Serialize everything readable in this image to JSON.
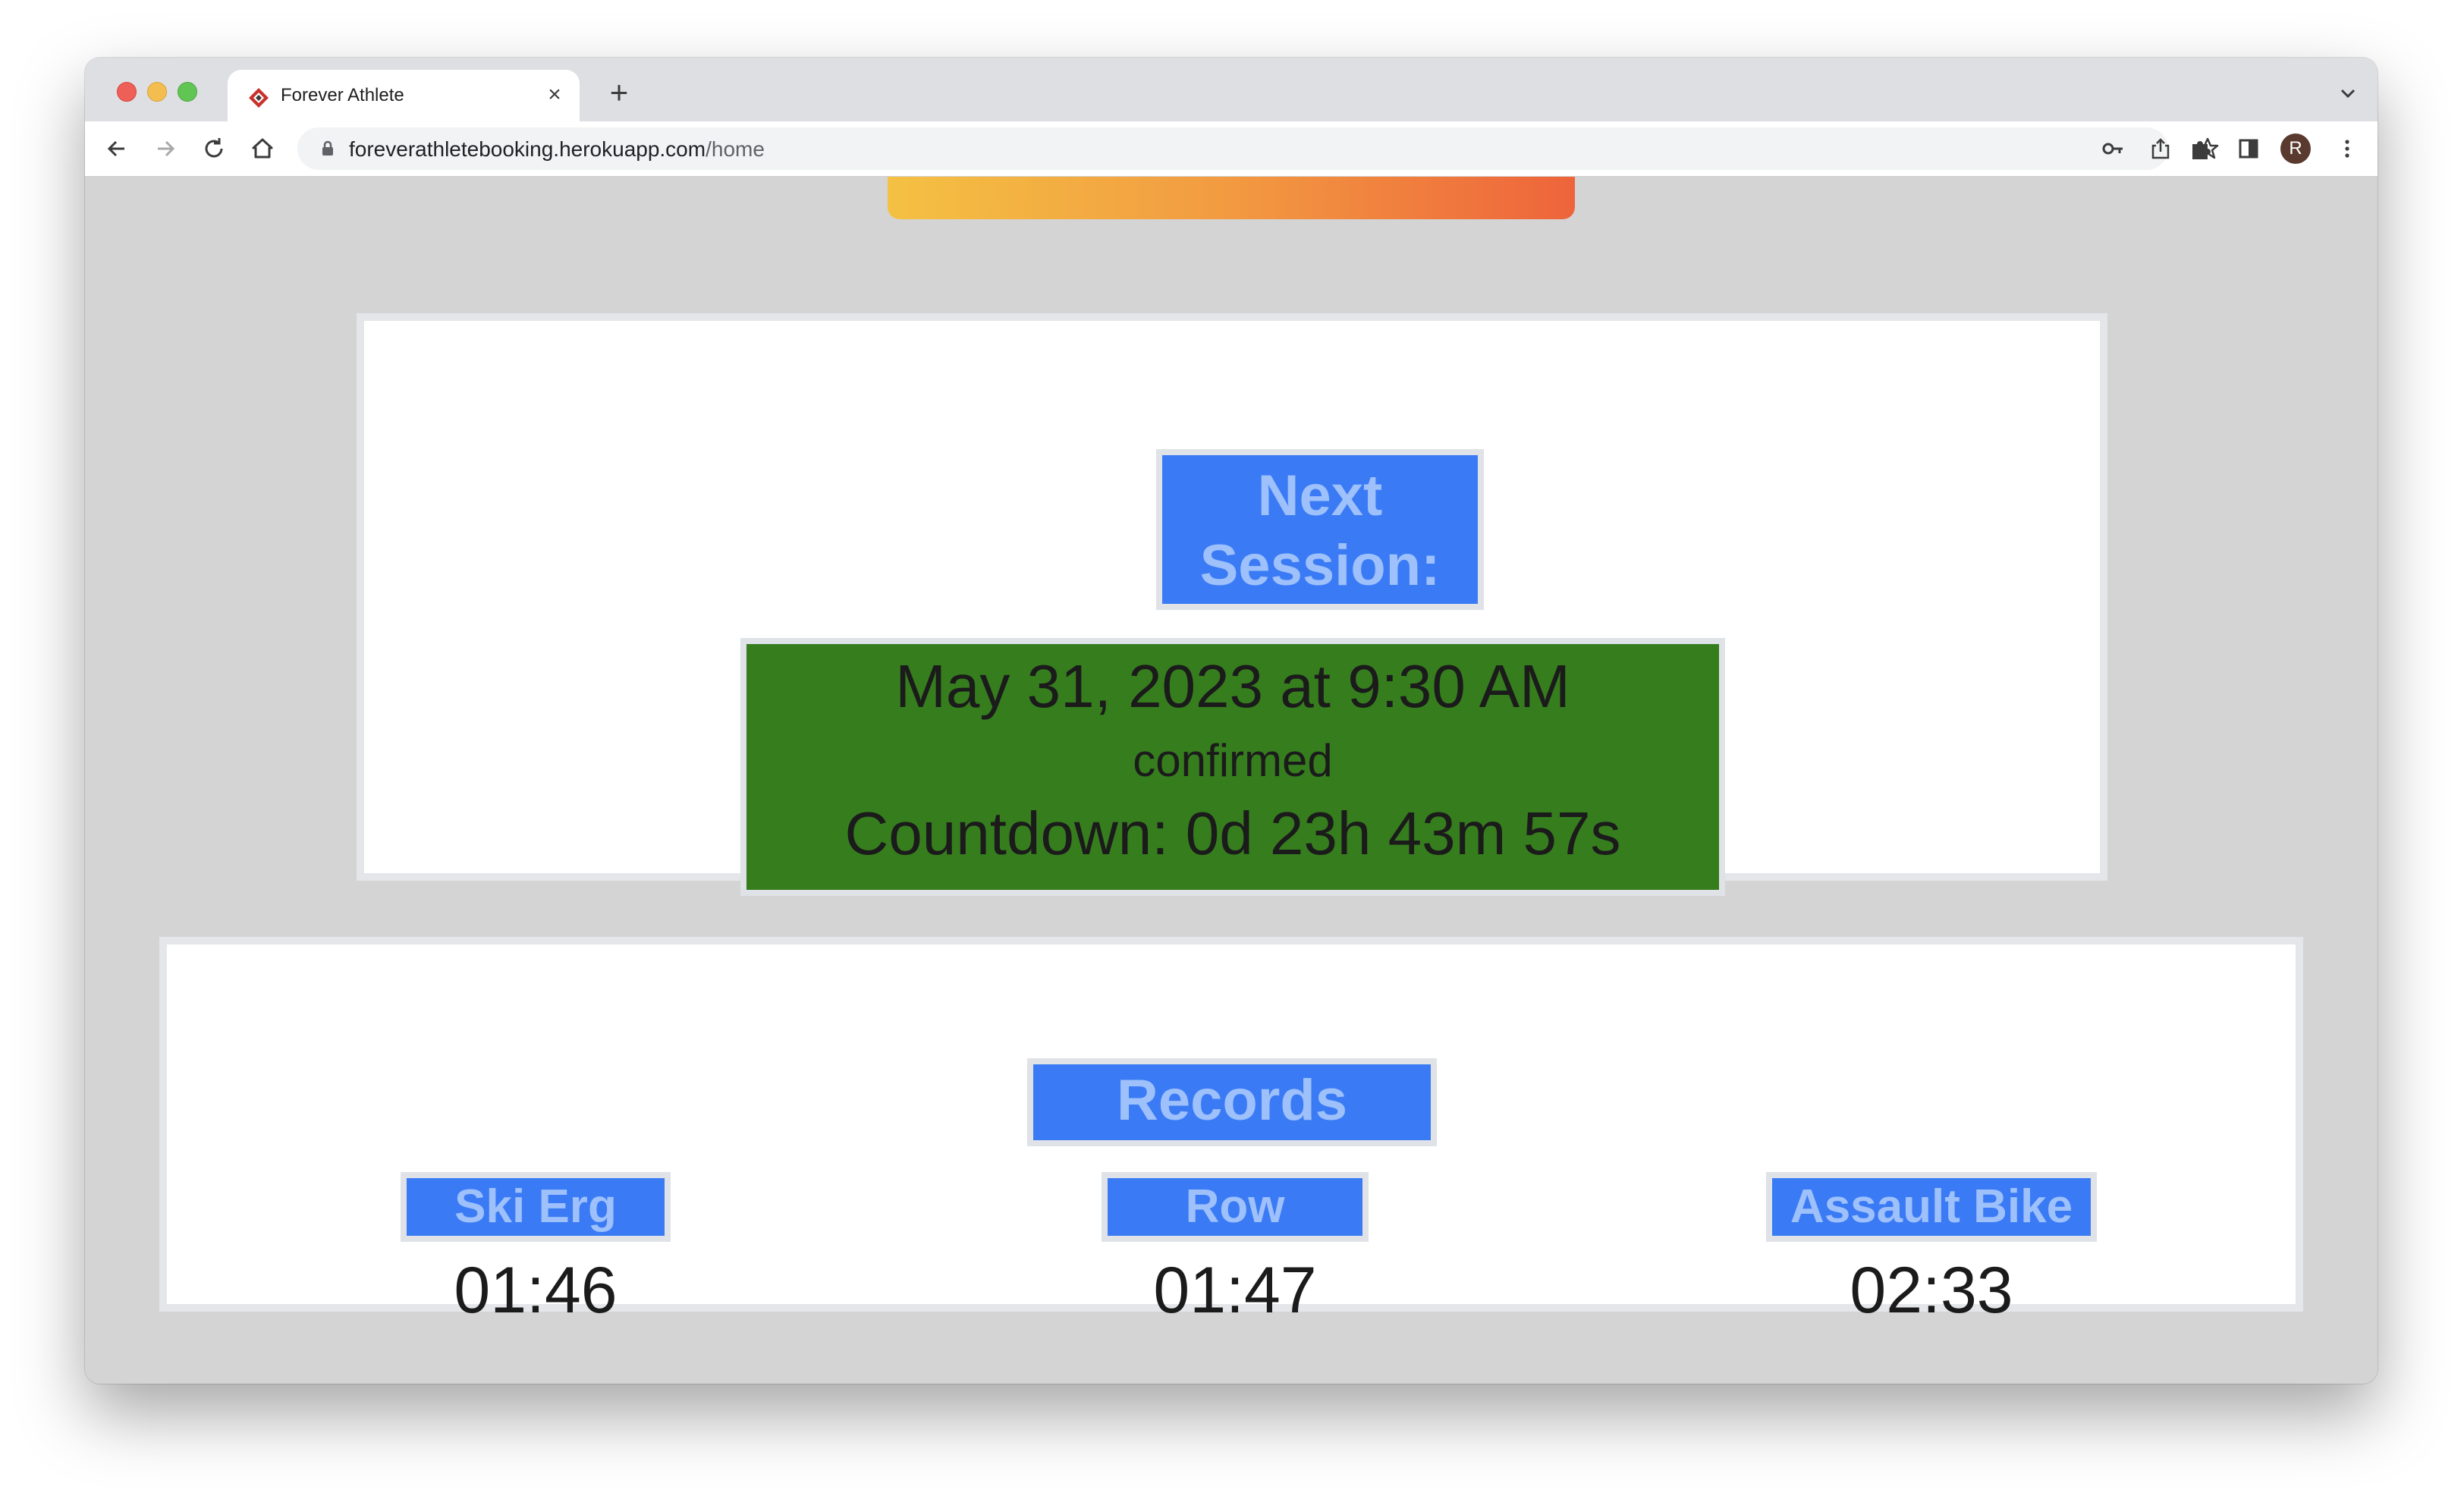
{
  "browser": {
    "tab_title": "Forever Athlete",
    "url_domain": "foreverathletebooking.herokuapp.com",
    "url_path": "/home",
    "profile_initial": "R"
  },
  "colors": {
    "banner_gradient": [
      "#f4c143",
      "#f29a41",
      "#ee643b"
    ],
    "label_blue": "#3a7bf5",
    "label_text": "#9ec0fb",
    "confirmed_green": "#367d1e",
    "page_background": "#d4d4d4"
  },
  "next_session": {
    "heading_line1": "Next",
    "heading_line2": "Session:",
    "date": "May 31, 2023 at 9:30 AM",
    "status": "confirmed",
    "countdown": "Countdown: 0d 23h 43m 57s"
  },
  "records": {
    "heading": "Records",
    "items": [
      {
        "label": "Ski Erg",
        "value": "01:46"
      },
      {
        "label": "Row",
        "value": "01:47"
      },
      {
        "label": "Assault Bike",
        "value": "02:33"
      }
    ]
  }
}
